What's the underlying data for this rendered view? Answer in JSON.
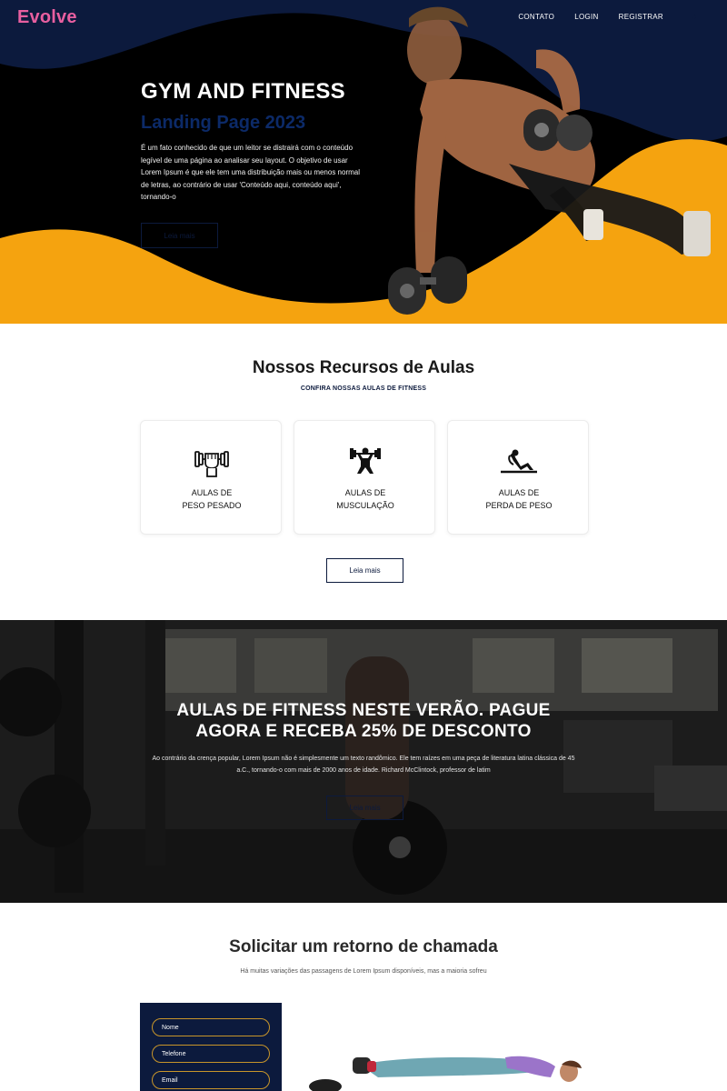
{
  "brand": {
    "logo": "Evolve"
  },
  "nav": {
    "items": [
      "CONTATO",
      "LOGIN",
      "REGISTRAR"
    ]
  },
  "hero": {
    "title": "GYM AND FITNESS",
    "subtitle": "Landing Page 2023",
    "text": "É um fato conhecido de que um leitor se distrairá com o conteúdo legível de uma página ao analisar seu layout. O objetivo de usar Lorem Ipsum é que ele tem uma distribuição mais ou menos normal de letras, ao contrário de usar 'Conteúdo aqui, conteúdo aqui', tornando-o",
    "button": "Leia mais"
  },
  "features": {
    "title": "Nossos Recursos de Aulas",
    "subtitle": "CONFIRA NOSSAS AULAS DE FITNESS",
    "cards": [
      {
        "line1": "AULAS DE",
        "line2": "PESO PESADO",
        "icon": "fist-dumbbell-icon"
      },
      {
        "line1": "AULAS DE",
        "line2": "MUSCULAÇÃO",
        "icon": "weightlifter-icon"
      },
      {
        "line1": "AULAS DE",
        "line2": "PERDA DE PESO",
        "icon": "situp-icon"
      }
    ],
    "button": "Leia mais"
  },
  "promo": {
    "title_line1": "AULAS DE FITNESS NESTE VERÃO. PAGUE",
    "title_line2": "AGORA E RECEBA 25% DE DESCONTO",
    "text": "Ao contrário da crença popular, Lorem Ipsum não é simplesmente um texto randômico. Ele tem raízes em uma peça de literatura latina clássica de 45 a.C., tornando-o com mais de 2000 anos de idade. Richard McClintock, professor de latim",
    "button": "Leia mais"
  },
  "callback": {
    "title": "Solicitar um retorno de chamada",
    "subtitle": "Há muitas variações das passagens de Lorem Ipsum disponíveis, mas a maioria sofreu",
    "fields": [
      "Nome",
      "Telefone",
      "Email"
    ]
  },
  "colors": {
    "accent_orange": "#f5a30f",
    "navy": "#0c1a3d",
    "logo_pink": "#e85fa0",
    "field_border": "#c8952a"
  }
}
